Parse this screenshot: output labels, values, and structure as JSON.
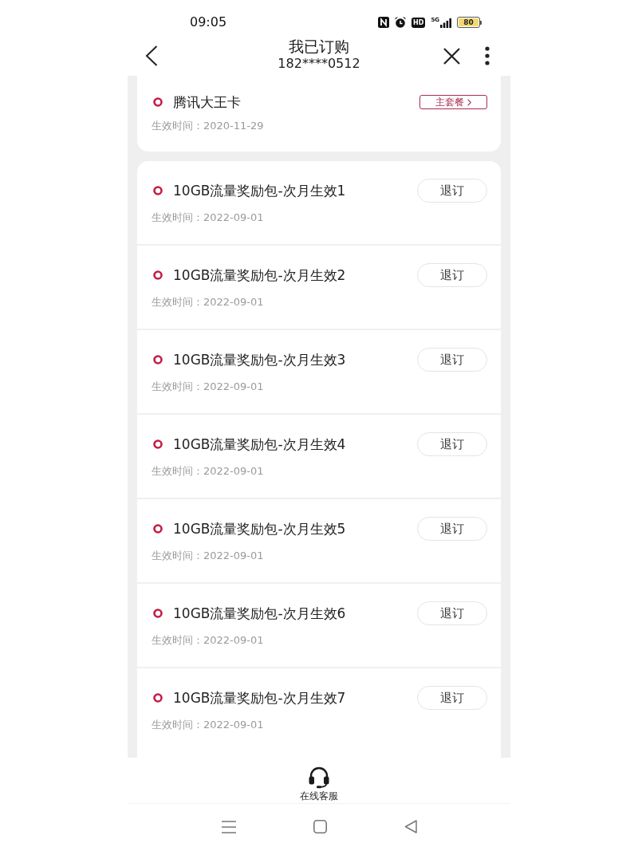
{
  "status_bar": {
    "time": "09:05",
    "hd_label": "HD",
    "network": "5G",
    "battery": "80"
  },
  "header": {
    "title": "我已订购",
    "subtitle": "182****0512"
  },
  "main_plan": {
    "name": "腾讯大王卡",
    "badge": "主套餐",
    "effective": "生效时间：2020-11-29"
  },
  "subscriptions": [
    {
      "name": "10GB流量奖励包-次月生效1",
      "effective": "生效时间：2022-09-01",
      "action": "退订"
    },
    {
      "name": "10GB流量奖励包-次月生效2",
      "effective": "生效时间：2022-09-01",
      "action": "退订"
    },
    {
      "name": "10GB流量奖励包-次月生效3",
      "effective": "生效时间：2022-09-01",
      "action": "退订"
    },
    {
      "name": "10GB流量奖励包-次月生效4",
      "effective": "生效时间：2022-09-01",
      "action": "退订"
    },
    {
      "name": "10GB流量奖励包-次月生效5",
      "effective": "生效时间：2022-09-01",
      "action": "退订"
    },
    {
      "name": "10GB流量奖励包-次月生效6",
      "effective": "生效时间：2022-09-01",
      "action": "退订"
    },
    {
      "name": "10GB流量奖励包-次月生效7",
      "effective": "生效时间：2022-09-01",
      "action": "退订"
    }
  ],
  "footer": {
    "service_label": "在线客服"
  }
}
